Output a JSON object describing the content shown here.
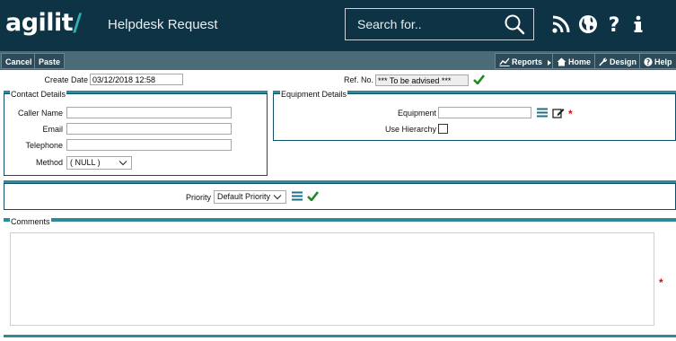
{
  "app": {
    "logo_text": "agilit",
    "logo_slash": "/",
    "title": "Helpdesk Request"
  },
  "search": {
    "placeholder": "Search for.."
  },
  "top_icons": [
    "rss-icon",
    "globe-icon",
    "help-question-icon",
    "info-icon"
  ],
  "toolbar": {
    "cancel_label": "Cancel",
    "paste_label": "Paste",
    "reports_label": "Reports",
    "home_label": "Home",
    "design_label": "Design",
    "help_label": "Help"
  },
  "header_fields": {
    "create_date_label": "Create Date",
    "create_date_value": "03/12/2018 12:58",
    "ref_no_label": "Ref. No.",
    "ref_no_value": "*** To be advised ***"
  },
  "contact": {
    "legend": "Contact Details",
    "caller_name_label": "Caller Name",
    "caller_name_value": "",
    "email_label": "Email",
    "email_value": "",
    "telephone_label": "Telephone",
    "telephone_value": "",
    "method_label": "Method",
    "method_value": "( NULL )"
  },
  "equipment": {
    "legend": "Equipment Details",
    "equipment_label": "Equipment",
    "equipment_value": "",
    "use_hierarchy_label": "Use Hierarchy",
    "use_hierarchy_checked": false
  },
  "priority": {
    "label": "Priority",
    "value": "Default Priority"
  },
  "comments": {
    "legend": "Comments",
    "value": ""
  },
  "colors": {
    "header_bg": "#0d3344",
    "toolbar_bg": "#4b6b78",
    "accent_teal": "#2d8a96",
    "confirm_green": "#1f8a1f",
    "required_red": "#d01010"
  },
  "required_marker": "*"
}
